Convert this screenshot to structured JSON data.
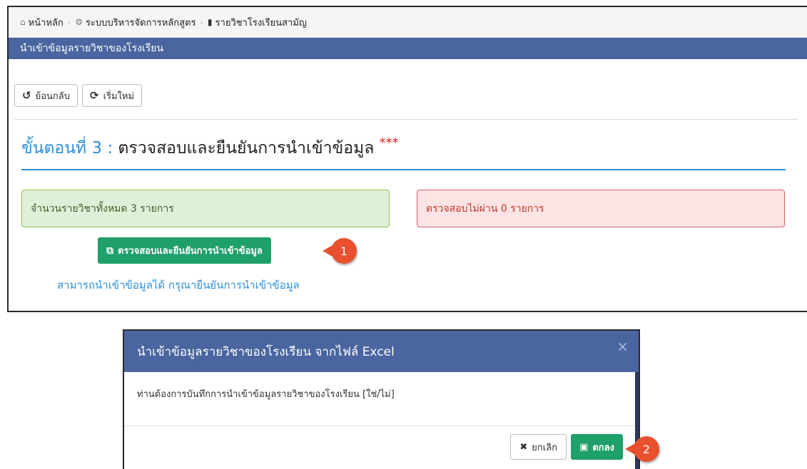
{
  "breadcrumb": {
    "home": "หน้าหลัก",
    "system": "ระบบบริหารจัดการหลักสูตร",
    "current": "รายวิชาโรงเรียนสามัญ",
    "home_icon": "home-icon",
    "system_icon": "cogs-icon",
    "current_icon": "bookmark-icon"
  },
  "panel": {
    "title": "นำเข้าข้อมูลรายวิชาของโรงเรียน",
    "header_color": "#4a659f"
  },
  "toolbar": {
    "back_label": "ย้อนกลับ",
    "restart_label": "เริ่มใหม่"
  },
  "step": {
    "prefix": "ขั้นตอนที่ 3 :",
    "title": "ตรวจสอบและยืนยันการนำเข้าข้อมูล",
    "required_mark": "***"
  },
  "alerts": {
    "success_text": "จำนวนรายวิชาทั้งหมด 3 รายการ",
    "danger_text": "ตรวจสอบไม่ผ่าน 0 รายการ"
  },
  "confirm_button": {
    "label": "ตรวจสอบและยืนยันการนำเข้าข้อมูล"
  },
  "hint": "สามารถนำเข้าข้อมูลได้ กรุณายืนยันการนำเข้าข้อมูล",
  "markers": {
    "one": "1",
    "two": "2",
    "color": "#e8502e"
  },
  "modal": {
    "title": "นำเข้าข้อมูลรายวิชาของโรงเรียน จากไฟล์ Excel",
    "body": "ท่านต้องการบันทึกการนำเข้าข้อมูลรายวิชาของโรงเรียน [ใช่/ไม่]",
    "cancel_label": "ยกเลิก",
    "ok_label": "ตกลง",
    "close_symbol": "×"
  }
}
